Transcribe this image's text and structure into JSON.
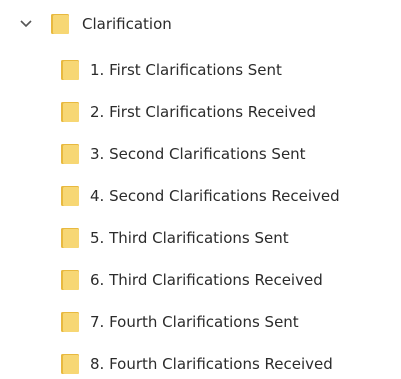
{
  "tree": {
    "parent": {
      "label": "Clarification",
      "expanded": true,
      "icon": "folder-icon",
      "chevron_icon": "chevron-down-icon"
    },
    "children": [
      {
        "label": "1. First Clarifications Sent",
        "icon": "folder-icon"
      },
      {
        "label": "2. First Clarifications Received",
        "icon": "folder-icon"
      },
      {
        "label": "3. Second Clarifications Sent",
        "icon": "folder-icon"
      },
      {
        "label": "4. Second Clarifications Received",
        "icon": "folder-icon"
      },
      {
        "label": "5. Third Clarifications Sent",
        "icon": "folder-icon"
      },
      {
        "label": "6. Third Clarifications Received",
        "icon": "folder-icon"
      },
      {
        "label": "7. Fourth Clarifications Sent",
        "icon": "folder-icon"
      },
      {
        "label": "8. Fourth Clarifications Received",
        "icon": "folder-icon"
      }
    ]
  },
  "colors": {
    "folder_fill": "#F7D774",
    "folder_back": "#E8B93F",
    "text": "#2B2B2B",
    "chevron": "#555555"
  }
}
